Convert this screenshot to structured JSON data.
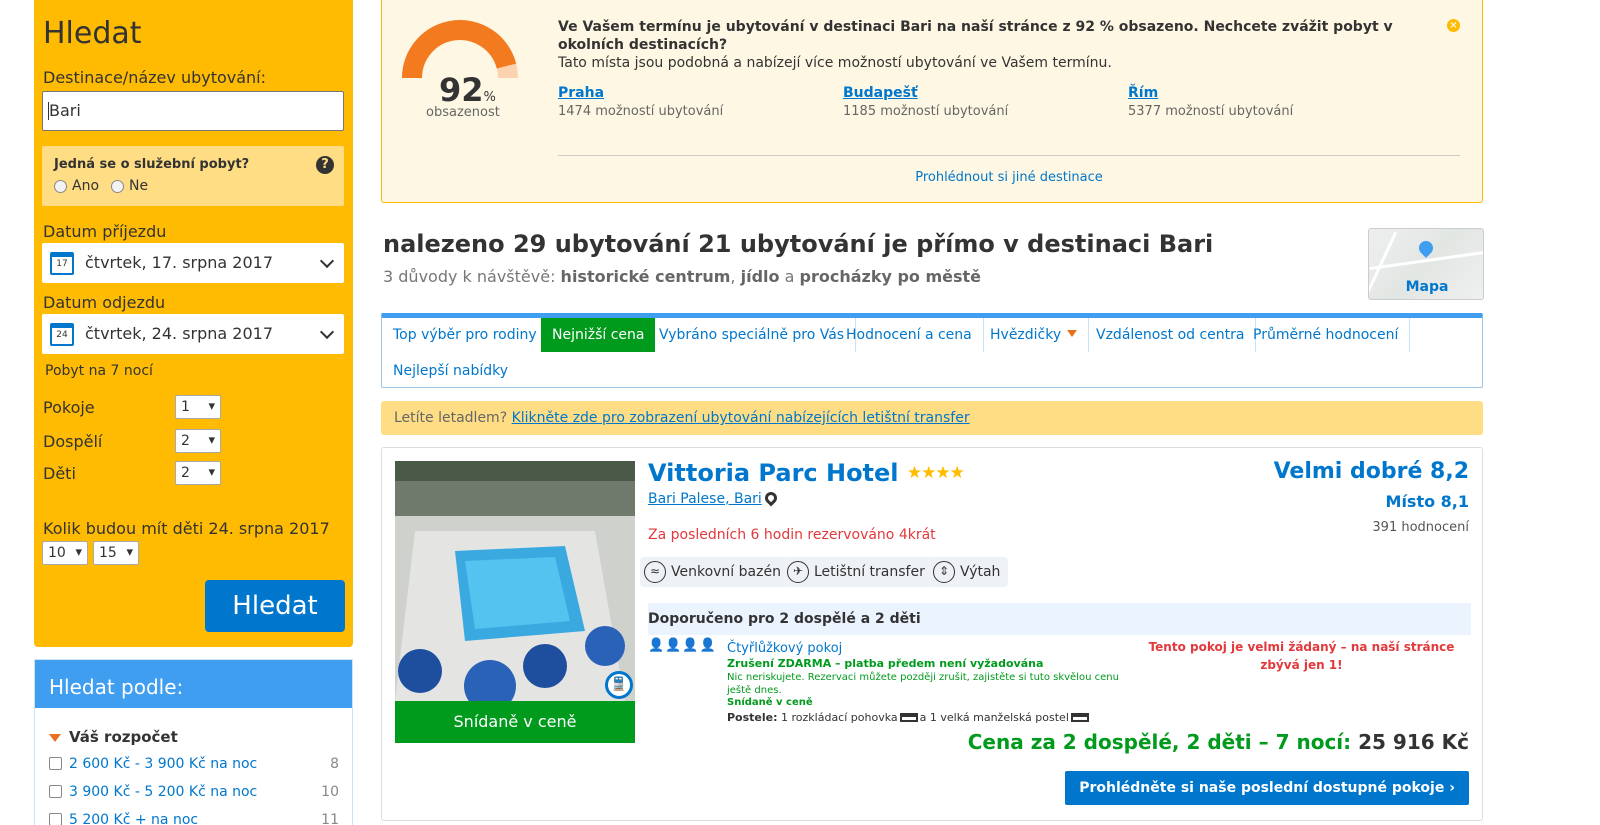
{
  "search": {
    "title": "Hledat",
    "dest_label": "Destinace/název ubytování:",
    "dest_value": "Bari",
    "business_question": "Jedná se o služební pobyt?",
    "business_help": "?",
    "radio_yes": "Ano",
    "radio_no": "Ne",
    "checkin_label": "Datum příjezdu",
    "checkin_day": "17",
    "checkin_value": "čtvrtek, 17. srpna 2017",
    "checkout_label": "Datum odjezdu",
    "checkout_day": "24",
    "checkout_value": "čtvrtek, 24. srpna 2017",
    "nights": "Pobyt na 7 nocí",
    "rooms_label": "Pokoje",
    "rooms_value": "1",
    "adults_label": "Dospělí",
    "adults_value": "2",
    "children_label": "Děti",
    "children_value": "2",
    "child_age_question": "Kolik budou mít děti 24. srpna 2017 let?",
    "child_age_1": "10",
    "child_age_2": "15",
    "button": "Hledat"
  },
  "filters": {
    "title": "Hledat podle:",
    "budget_title": "Váš rozpočet",
    "budget": [
      {
        "label": "2 600 Kč - 3 900 Kč na noc",
        "count": "8"
      },
      {
        "label": "3 900 Kč - 5 200 Kč na noc",
        "count": "10"
      },
      {
        "label": "5 200 Kč + na noc",
        "count": "11"
      }
    ]
  },
  "occupancy": {
    "percent": "92",
    "percent_sign": "%",
    "percent_value": 0.92,
    "label": "obsazenost",
    "title": "Ve Vašem termínu je ubytování v destinaci Bari na naší stránce z 92 % obsazeno. Nechcete zvážit pobyt v okolních destinacích?",
    "subtitle": "Tato místa jsou podobná a nabízejí více možností ubytování ve Vašem termínu.",
    "close": "×",
    "destinations": [
      {
        "name": "Praha",
        "count": "1474 možností ubytování"
      },
      {
        "name": "Budapešť",
        "count": "1185 možností ubytování"
      },
      {
        "name": "Řím",
        "count": "5377 možností ubytování"
      }
    ],
    "more_link": "Prohlédnout si jiné destinace",
    "gauge_colors": [
      "#f47a20",
      "#fbd3b0"
    ]
  },
  "results": {
    "title": "nalezeno 29 ubytování 21 ubytování je přímo v destinaci Bari",
    "reasons_prefix": "3 důvody k návštěvě:",
    "reason_1": "historické centrum",
    "reason_sep_1": ",",
    "reason_2": "jídlo",
    "reason_sep_2": "a",
    "reason_3": "procházky po městě",
    "map_label": "Mapa"
  },
  "sort_tabs": [
    {
      "label": "Top výběr pro rodiny"
    },
    {
      "label": "Nejnižší cena"
    },
    {
      "label": "Vybráno speciálně pro Vás"
    },
    {
      "label": "Hodnocení a cena"
    },
    {
      "label": "Hvězdičky"
    },
    {
      "label": "Vzdálenost od centra"
    },
    {
      "label": "Průměrné hodnocení"
    },
    {
      "label": "Nejlepší nabídky"
    }
  ],
  "air_notice": {
    "text": "Letíte letadlem?",
    "link": "Klikněte zde pro zobrazení ubytování nabízejících letištní transfer"
  },
  "hotel": {
    "name": "Vittoria Parc Hotel",
    "stars": "★★★★",
    "location": "Bari Palese, Bari",
    "booked": "Za posledních 6 hodin rezervováno 4krát",
    "amenities": [
      "Venkovní bazén",
      "Letištní transfer",
      "Výtah"
    ],
    "photo_badge": "Snídaně v ceně",
    "train_icon": "🚆",
    "rating_word": "Velmi dobré 8,2",
    "location_score": "Místo 8,1",
    "reviews": "391 hodnocení",
    "recommended": "Doporučeno pro 2 dospělé a 2 děti",
    "people": "👤👤👤👤",
    "room_type": "Čtyřlůžkový pokoj",
    "cancel_free": "Zrušení ZDARMA – platba předem není vyžadována",
    "cancel_desc": "Nic neriskujete. Rezervaci můžete později zrušit, zajistěte si tuto skvělou cenu ještě dnes.",
    "breakfast_inc": "Snídaně v ceně",
    "beds_label": "Postele:",
    "beds_1": "1 rozkládací pohovka",
    "beds_2": "a 1 velká manželská postel",
    "demand": "Tento pokoj je velmi žádaný – na naší stránce zbývá jen 1!",
    "price_prefix": "Cena za 2 dospělé, 2 děti – 7 nocí:",
    "price": "25 916 Kč",
    "cta": "Prohlédněte si naše poslední dostupné pokoje ›"
  },
  "colors": {
    "brand_blue": "#0077cc",
    "yellow": "#febb02",
    "green": "#009a1d",
    "red": "#e2393d"
  }
}
